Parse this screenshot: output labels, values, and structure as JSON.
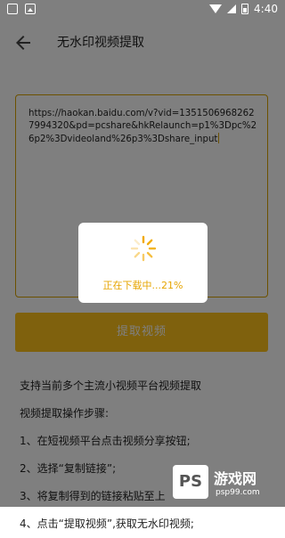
{
  "statusbar": {
    "time": "4:40"
  },
  "appbar": {
    "title": "无水印视频提取"
  },
  "url_input": {
    "value": "https://haokan.baidu.com/v?vid=13515069682627994320&pd=pcshare&hkRelaunch=p1%3Dpc%26p2%3Dvideoland%26p3%3Dshare_input"
  },
  "extract_button": {
    "label": "提取视频"
  },
  "instructions": {
    "intro": "支持当前多个主流小视频平台视频提取",
    "steps_title": "视频提取操作步骤:",
    "step1": "1、在短视频平台点击视频分享按钮;",
    "step2": "2、选择“复制链接”;",
    "step3": "3、将复制得到的链接粘贴至上",
    "step4": "4、点击“提取视频”,获取无水印视频;"
  },
  "dialog": {
    "progress_text": "正在下载中...21%",
    "progress_percent": 21
  },
  "watermark": {
    "logo": "PS",
    "name": "游戏网",
    "url": "psp99.com"
  },
  "colors": {
    "accent": "#ffc21a",
    "progress_text": "#e6a400",
    "border": "#d9a300"
  }
}
